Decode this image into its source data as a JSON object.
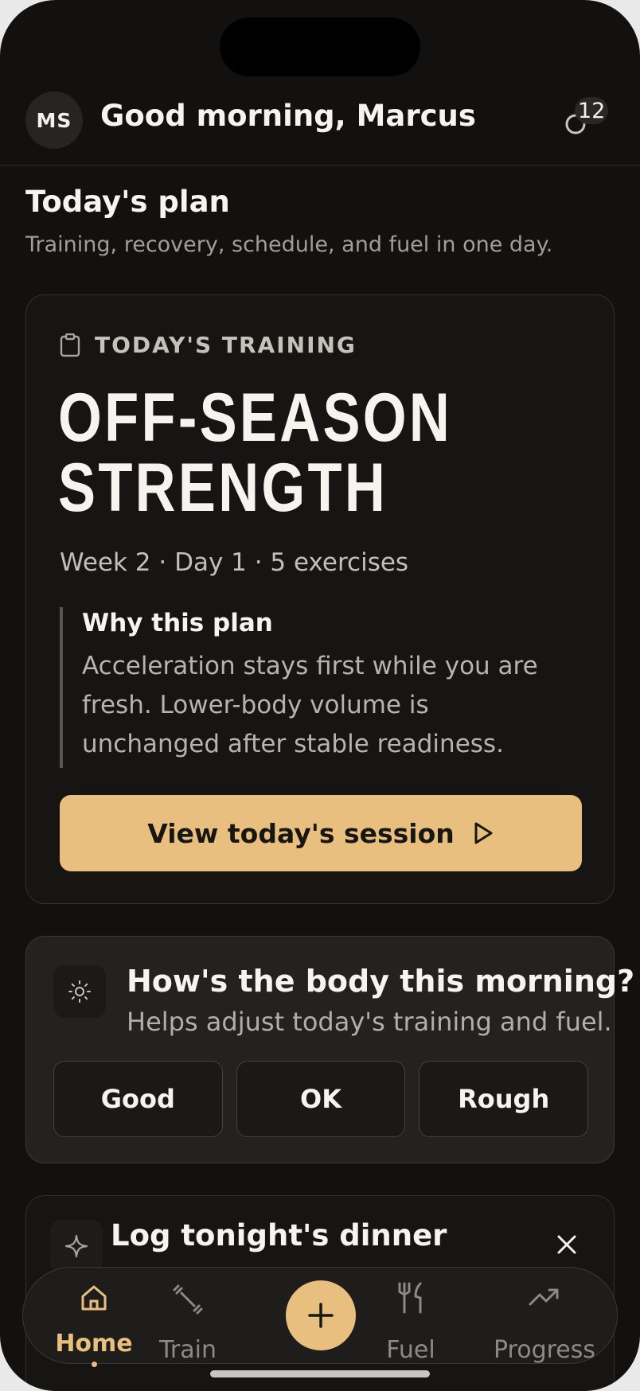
{
  "header": {
    "avatar_initials": "MS",
    "greeting": "Good morning, Marcus",
    "notification_count": "12"
  },
  "plan": {
    "title": "Today's plan",
    "subtitle": "Training, recovery, schedule, and fuel in one day."
  },
  "training": {
    "label": "TODAY'S TRAINING",
    "title": "OFF-SEASON STRENGTH",
    "meta": "Week 2 · Day 1 · 5 exercises",
    "why_title": "Why this plan",
    "why_text": "Acceleration stays first while you are fresh. Lower-body volume is unchanged after stable readiness.",
    "cta_label": "View today's session"
  },
  "readiness": {
    "title": "How's the body this morning?",
    "subtitle": "Helps adjust today's training and fuel.",
    "options": [
      "Good",
      "OK",
      "Rough"
    ]
  },
  "dinner": {
    "title": "Log tonight's dinner"
  },
  "nav": {
    "items": [
      {
        "label": "Home",
        "icon": "home-icon",
        "active": true
      },
      {
        "label": "Train",
        "icon": "dumbbell-icon",
        "active": false
      },
      {
        "label": "Fuel",
        "icon": "utensils-icon",
        "active": false
      },
      {
        "label": "Progress",
        "icon": "trending-up-icon",
        "active": false
      }
    ],
    "add_icon": "plus-icon"
  },
  "colors": {
    "background": "#121110",
    "accent": "#e9bf7f",
    "card": "#161513",
    "text": "#f6f4ef",
    "muted": "#a29e97"
  }
}
